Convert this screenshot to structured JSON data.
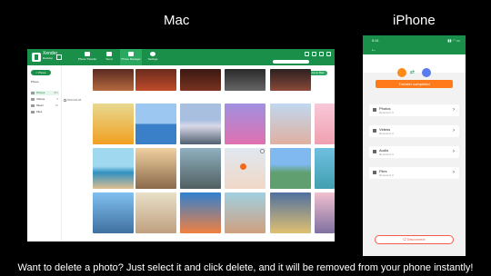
{
  "titles": {
    "mac": "Mac",
    "iphone": "iPhone"
  },
  "caption": "Want to delete a photo? Just select it and click delete, and it will be removed from your phone instantly!",
  "mac": {
    "brand_line1": "Xender",
    "brand_line2": "Desktop",
    "tabs": [
      {
        "label": "Phone Transfer"
      },
      {
        "label": "Send"
      },
      {
        "label": "Phone Manager"
      },
      {
        "label": "Settings"
      }
    ],
    "back_label": "< Phone",
    "sidebar_head": "Phone",
    "sidebar": [
      {
        "label": "Photos",
        "count": "467"
      },
      {
        "label": "Videos",
        "count": "8"
      },
      {
        "label": "Music",
        "count": "10"
      },
      {
        "label": "Files",
        "count": ""
      }
    ],
    "export_label": "Export Selected Items to Mac",
    "date_header": "2024-06-06"
  },
  "phone": {
    "time": "9:41",
    "status": "▮▮ ◠ ▭",
    "back": "←",
    "transfer_label": "Transfer completed",
    "items": [
      {
        "label": "Photos",
        "sub": "Received: 0"
      },
      {
        "label": "Videos",
        "sub": "Received: 0"
      },
      {
        "label": "Audio",
        "sub": "Received: 0"
      },
      {
        "label": "Files",
        "sub": "Received: 0"
      }
    ],
    "chevron": "›",
    "disconnect_label": "Disconnect"
  },
  "colors": {
    "brand": "#1a8f4a",
    "accent": "#ff7a1a",
    "danger": "#f25a4a"
  }
}
